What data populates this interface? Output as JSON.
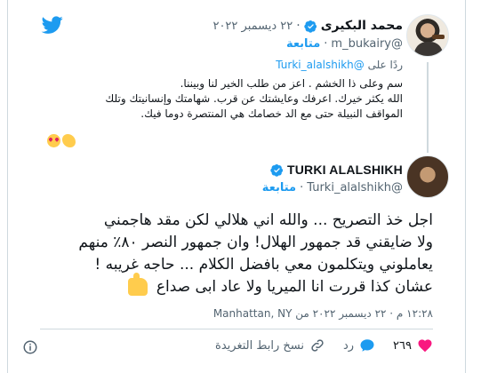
{
  "reply_tweet": {
    "author_name": "محمد البكيرى",
    "date": "٢٢ ديسمبر ٢٠٢٢",
    "handle": "@m_bukairy",
    "follow_label": "متابعة",
    "reply_prefix": "ردًا على",
    "reply_to_handle": "@Turki_alalshikh",
    "text_lines": [
      "سم وعلى ذا الخشم . اعز من طلب الخير لنا وبيننا.",
      "الله يكثر خيرك. اعرفك وعايشتك عن قرب. شهامتك وإنسانيتك وتلك",
      "المواقف النبيلة حتى مع الد خصامك هي المنتصرة دوما فيك."
    ]
  },
  "main_tweet": {
    "author_name": "TURKI ALALSHIKH",
    "handle": "@Turki_alalshikh",
    "follow_label": "متابعة",
    "text_lines": [
      "اجل خذ التصريح ... والله اني هلالي لكن مقد هاجمني",
      "ولا ضايقني قد جمهور الهلال! وان جمهور النصر ٨٠٪ منهم",
      "يعاملوني ويتكلمون معي بافضل الكلام ... حاجه غريبه !",
      "عشان كذا قررت انا الميريا ولا عاد ابى صداع"
    ],
    "timestamp": "١٢:٢٨ م · ٢٢ ديسمبر ٢٠٢٢ من Manhattan, NY"
  },
  "actions": {
    "like_count": "٢٦٩",
    "reply_label": "رد",
    "copy_link_label": "نسخ رابط التغريدة"
  },
  "colors": {
    "twitter_blue": "#1d9bf0",
    "like_red": "#f91880",
    "text_secondary": "#536471"
  },
  "icons": {
    "logo": "twitter-bird-icon",
    "verified": "verified-badge-icon",
    "like": "heart-icon",
    "reply": "speech-bubble-icon",
    "copy": "link-icon",
    "info": "info-icon"
  }
}
